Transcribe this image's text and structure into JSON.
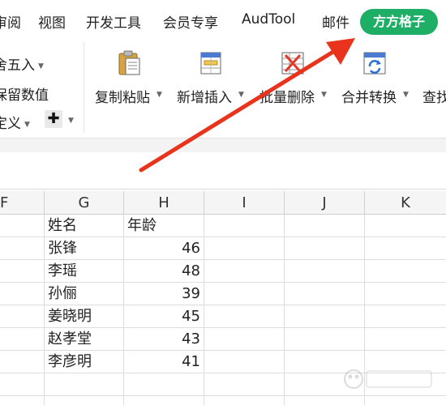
{
  "menubar": {
    "items": [
      {
        "label": "审阅"
      },
      {
        "label": "视图"
      },
      {
        "label": "开发工具"
      },
      {
        "label": "会员专享"
      },
      {
        "label": "AudTool"
      },
      {
        "label": "邮件"
      }
    ],
    "highlight": {
      "label": "方方格子",
      "color": "#1fae66"
    }
  },
  "ribbon": {
    "left_items": [
      {
        "label": "舍五入",
        "icon": "chevron-down-icon"
      },
      {
        "label": "保留数值"
      },
      {
        "label": "定义",
        "icon": "chevron-down-icon"
      }
    ],
    "plus_label": "✚",
    "buttons": [
      {
        "label": "复制粘贴",
        "icon": "clipboard-paste-icon"
      },
      {
        "label": "新增插入",
        "icon": "insert-table-icon"
      },
      {
        "label": "批量删除",
        "icon": "delete-table-icon"
      },
      {
        "label": "合并转换",
        "icon": "merge-convert-icon"
      },
      {
        "label": "查找",
        "icon": "find-icon"
      }
    ]
  },
  "sheet": {
    "columns": [
      "F",
      "G",
      "H",
      "I",
      "J",
      "K"
    ],
    "header_row": [
      "姓名",
      "年龄"
    ],
    "rows": [
      {
        "name": "张锋",
        "age": "46"
      },
      {
        "name": "李瑶",
        "age": "48"
      },
      {
        "name": "孙俪",
        "age": "39"
      },
      {
        "name": "姜晓明",
        "age": "45"
      },
      {
        "name": "赵孝堂",
        "age": "43"
      },
      {
        "name": "李彦明",
        "age": "41"
      }
    ]
  },
  "annotation": {
    "color": "#e8341c"
  },
  "watermark": {
    "icon": "baidu-jingyan-watermark-icon"
  }
}
